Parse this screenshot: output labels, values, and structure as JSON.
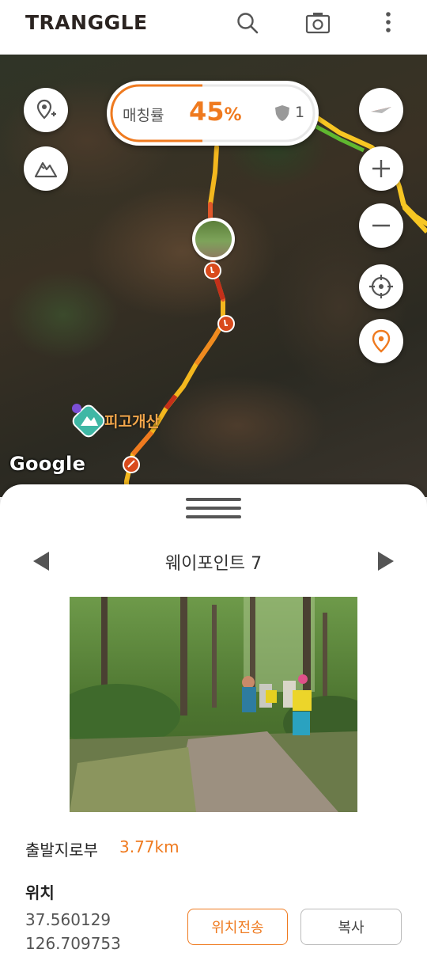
{
  "app": {
    "logo_text": "TRANGGLE"
  },
  "topbar": {
    "icons": [
      "search-icon",
      "camera-icon",
      "more-vertical-icon"
    ]
  },
  "map": {
    "match": {
      "label": "매칭률",
      "value": "45",
      "unit": "%",
      "shield_count": "1"
    },
    "peak_name": "피고개산",
    "attribution": "Google",
    "left_buttons": [
      "add-location-icon",
      "mountain-icon"
    ],
    "right_buttons": [
      "compass-icon",
      "zoom-in-icon",
      "zoom-out-icon",
      "my-location-icon",
      "location-pin-icon"
    ]
  },
  "sheet": {
    "waypoint_title": "웨이포인트 7",
    "distance_label": "출발지로부",
    "distance_value": "3.77km",
    "location_label": "위치",
    "latitude": "37.560129",
    "longitude": "126.709753",
    "send_button": "위치전송",
    "copy_button": "복사"
  },
  "colors": {
    "accent": "#ef7a1f",
    "route_yellow": "#f7c623",
    "route_red": "#d9381e"
  }
}
